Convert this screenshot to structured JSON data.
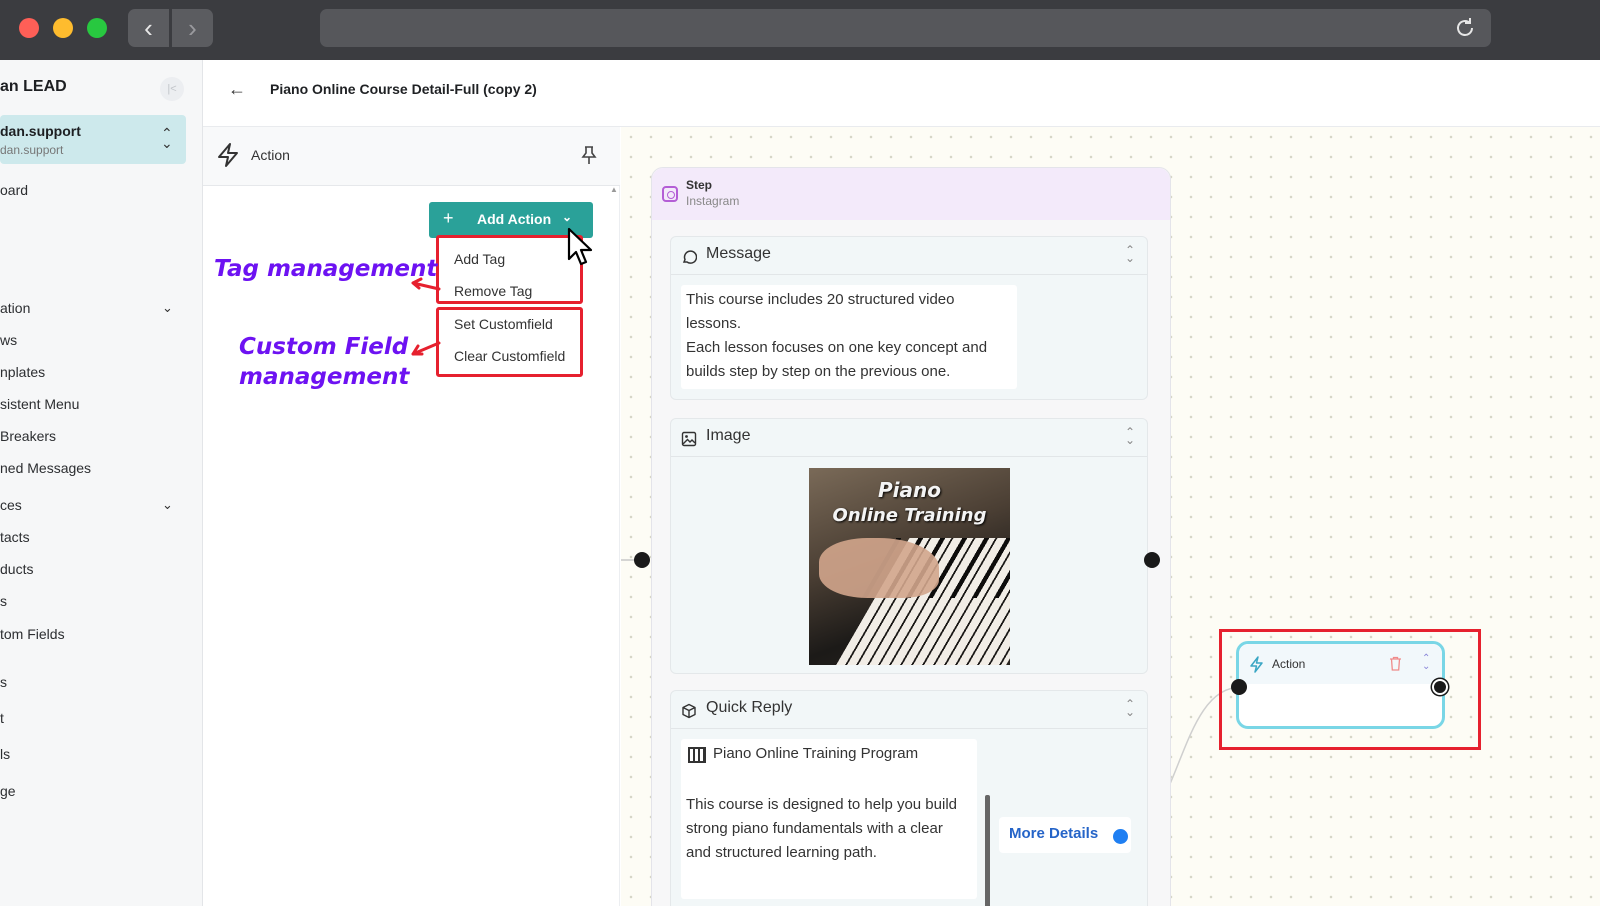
{
  "browser": {
    "back_glyph": "‹",
    "forward_glyph": "›"
  },
  "sidebar": {
    "brand": "an LEAD",
    "collapse_glyph": "|<",
    "account_name": "dan.support",
    "account_sub": "dan.support",
    "items": [
      "oard",
      "ation",
      "ws",
      "nplates",
      "sistent Menu",
      "Breakers",
      "ned Messages",
      "ces",
      "tacts",
      "ducts",
      "s",
      "tom Fields",
      "s",
      "t",
      "ls",
      "ge"
    ]
  },
  "header": {
    "back_glyph": "←",
    "title": "Piano Online Course Detail-Full (copy 2)"
  },
  "action_panel": {
    "title": "Action",
    "add_action_label": "Add Action",
    "menu_tag": [
      "Add Tag",
      "Remove Tag"
    ],
    "menu_field": [
      "Set Customfield",
      "Clear Customfield"
    ]
  },
  "annotations": {
    "tag": "Tag management",
    "field_line1": "Custom Field",
    "field_line2": "management"
  },
  "step": {
    "title": "Step",
    "platform": "Instagram",
    "message_title": "Message",
    "message_text": "This course includes 20 structured video lessons.\nEach lesson focuses on one key concept and builds step by step on the previous one.",
    "image_title": "Image",
    "image_text_1": "Piano",
    "image_text_2": "Online Training",
    "quick_reply_title": "Quick Reply",
    "qr_card_title": "Piano Online Training Program",
    "qr_card_body": "This course is designed to help you build strong piano fundamentals with a clear and structured learning path.",
    "qr_button": "More Details"
  },
  "action_node": {
    "title": "Action"
  },
  "colors": {
    "accent": "#2aa199",
    "highlight": "#e6202e",
    "annotation": "#6d12f2",
    "link": "#2564c8"
  },
  "icons": [
    "back-arrow-icon",
    "forward-arrow-icon",
    "reload-icon",
    "bolt-icon",
    "pin-icon",
    "plus-icon",
    "chevron-down-icon",
    "instagram-icon",
    "message-bubble-icon",
    "image-icon",
    "cube-icon",
    "piano-icon",
    "trash-icon",
    "cursor-icon"
  ]
}
